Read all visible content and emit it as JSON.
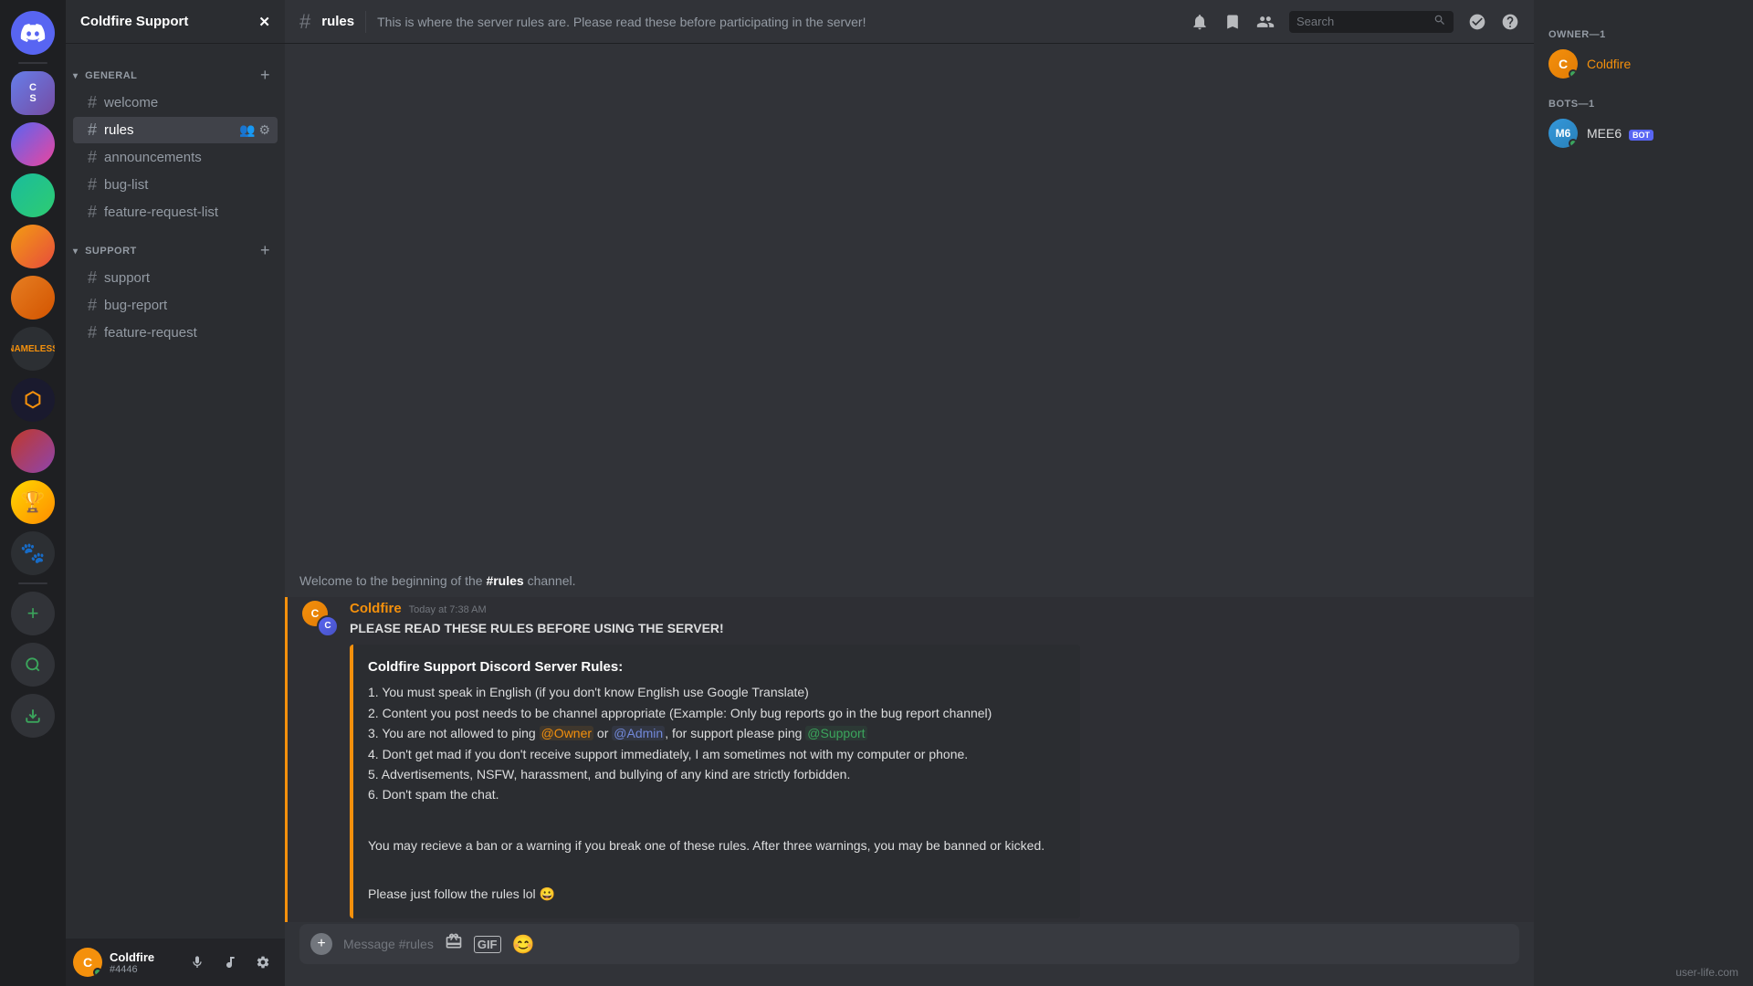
{
  "app": {
    "watermark": "user-life.com"
  },
  "server": {
    "name": "Coldfire Support",
    "chevron": "▾"
  },
  "categories": [
    {
      "name": "GENERAL",
      "channels": [
        {
          "name": "welcome",
          "active": false
        },
        {
          "name": "rules",
          "active": true
        },
        {
          "name": "announcements",
          "active": false
        },
        {
          "name": "bug-list",
          "active": false
        },
        {
          "name": "feature-request-list",
          "active": false
        }
      ]
    },
    {
      "name": "SUPPORT",
      "channels": [
        {
          "name": "support",
          "active": false
        },
        {
          "name": "bug-report",
          "active": false
        },
        {
          "name": "feature-request",
          "active": false
        }
      ]
    }
  ],
  "current_channel": {
    "name": "rules",
    "topic": "This is where the server rules are. Please read these before participating in the server!"
  },
  "user": {
    "name": "Coldfire",
    "tag": "#4446",
    "avatar_color": "#f4900c"
  },
  "message_input_placeholder": "Message #rules",
  "welcome_message": "Welcome to the beginning of the",
  "welcome_channel": "#rules",
  "welcome_suffix": "channel.",
  "message": {
    "author": "Coldfire",
    "timestamp": "Today at 7:38 AM",
    "bold_text": "PLEASE READ THESE RULES BEFORE USING THE SERVER!",
    "embed": {
      "title": "Coldfire Support Discord Server Rules:",
      "rules": [
        "1. You must speak in English (if you don't know English use Google Translate)",
        "2. Content you post needs to be channel appropriate (Example: Only bug reports go in the bug report channel)",
        "3. You are not allowed to ping",
        "4. Don't get mad if you don't receive support immediately, I am sometimes not with my computer or phone.",
        "5. Advertisements, NSFW, harassment, and bullying of any kind are strictly forbidden.",
        "6. Don't spam the chat."
      ],
      "rule3_mentions": [
        {
          "text": "@Owner",
          "color": "orange"
        },
        {
          "text": "or",
          "plain": true
        },
        {
          "text": "@Admin",
          "color": "blue"
        },
        {
          "text": ", for support please ping",
          "plain": true
        },
        {
          "text": "@Support",
          "color": "green"
        }
      ]
    },
    "ban_text": "You may recieve a ban or a warning if you break one of these rules. After three warnings, you may be banned or kicked.",
    "follow_text": "Please just follow the rules lol 😀"
  },
  "members": {
    "owner_section": "OWNER—1",
    "bots_section": "BOTS—1",
    "owner": {
      "name": "Coldfire",
      "status": "online"
    },
    "bot": {
      "name": "MEE6",
      "badge": "BOT"
    }
  },
  "header": {
    "search_placeholder": "Search",
    "icons": [
      "🔔",
      "📌",
      "👥"
    ]
  }
}
